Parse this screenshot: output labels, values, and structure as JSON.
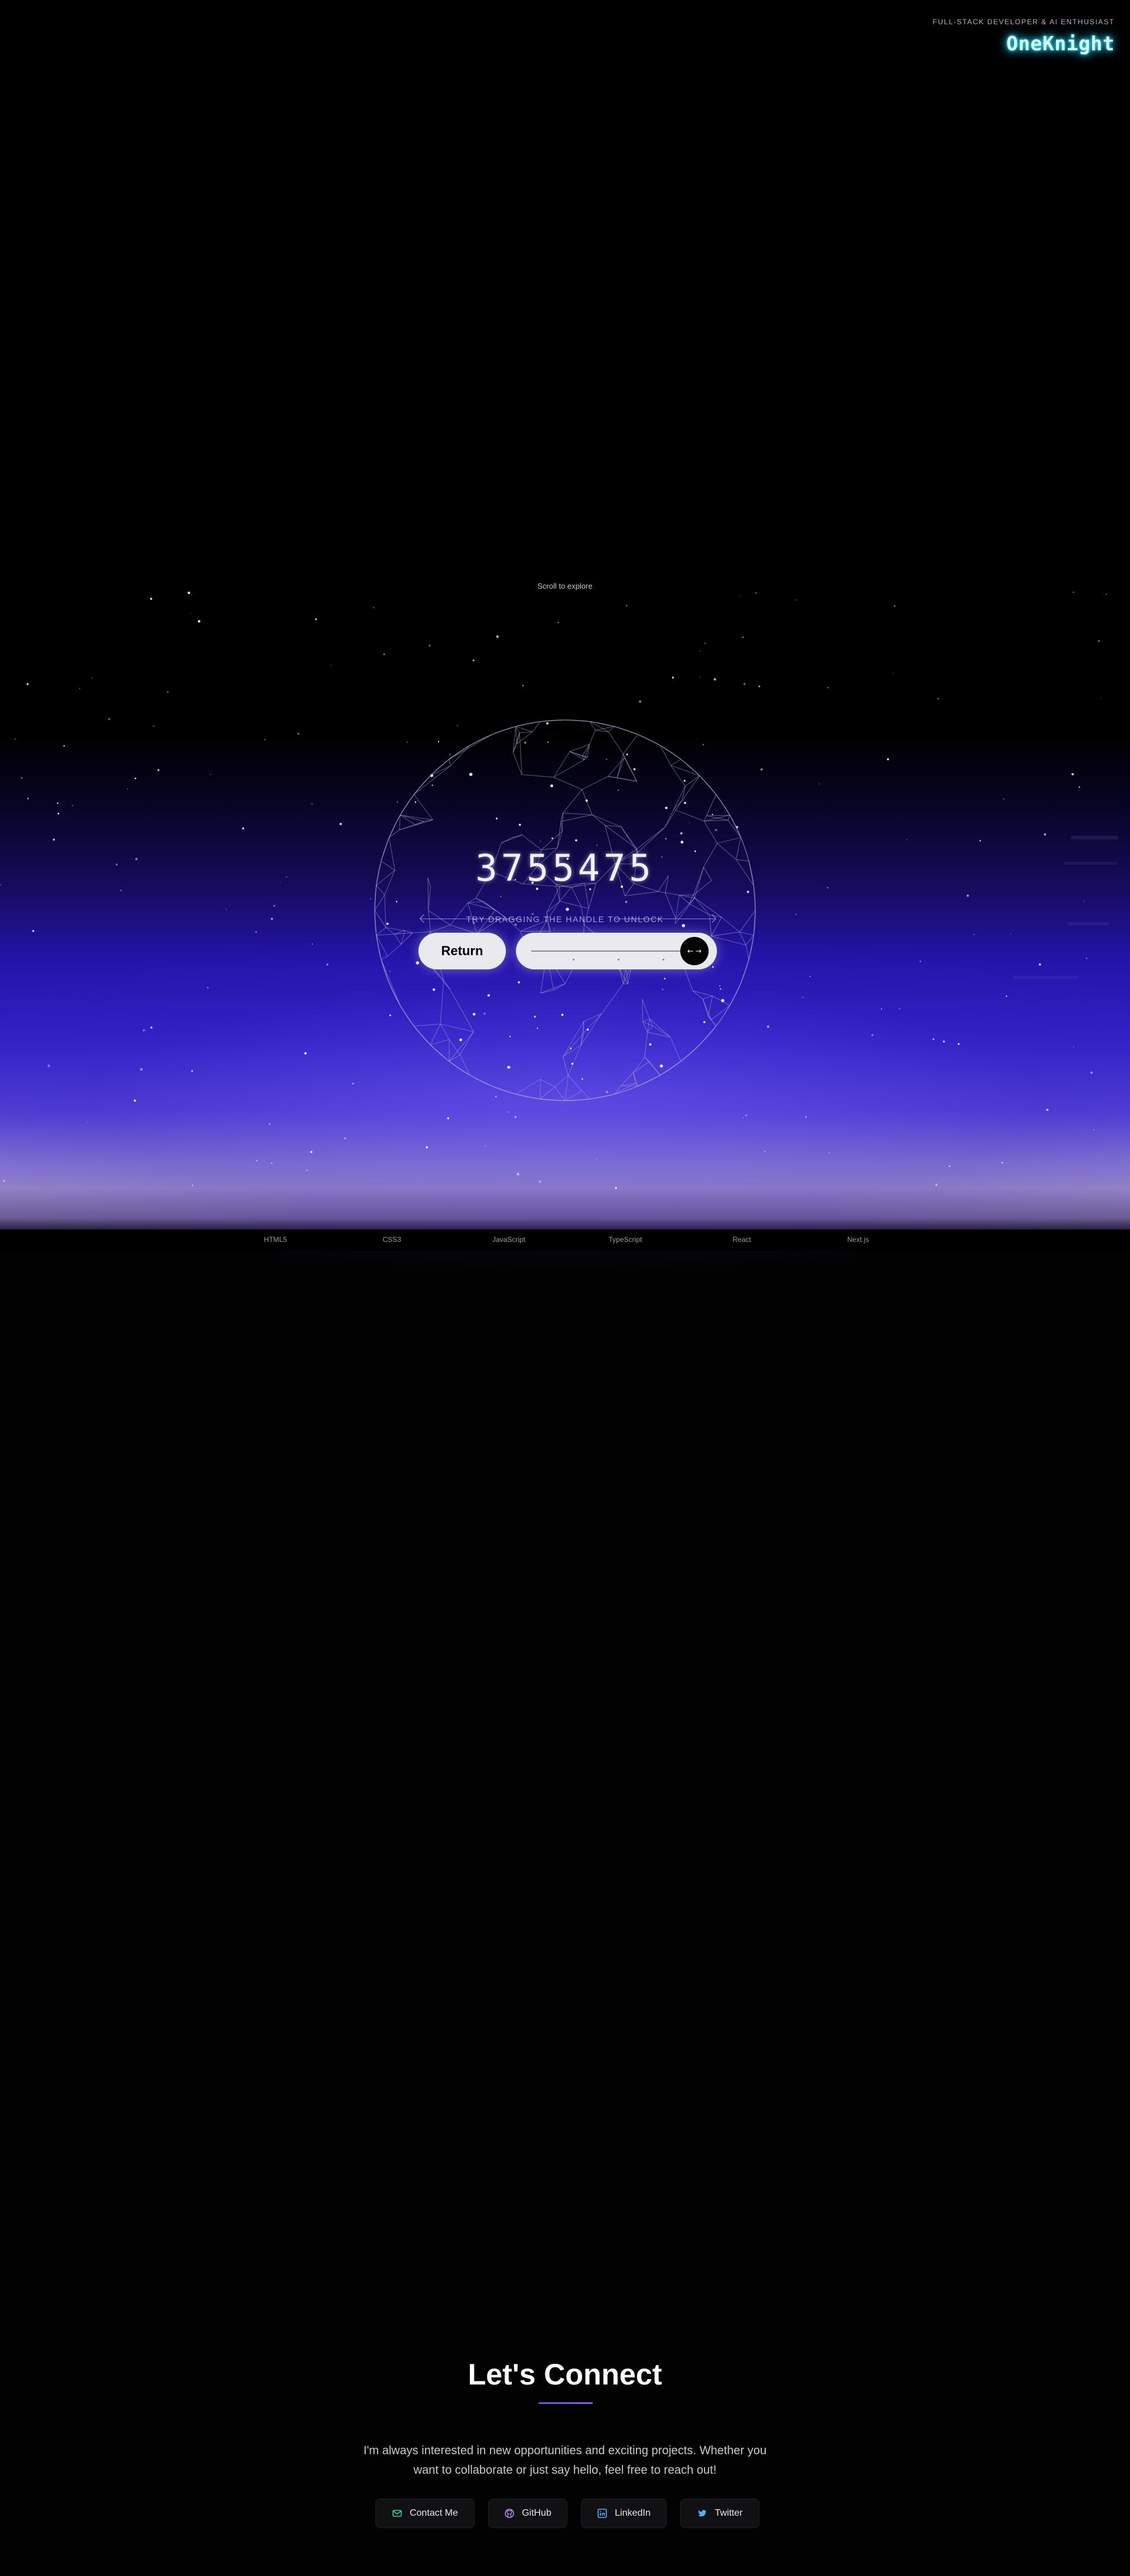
{
  "header": {
    "tagline": "FULL-STACK DEVELOPER & AI ENTHUSIAST",
    "logo": "OneKnight"
  },
  "hero": {
    "scroll_hint": "Scroll to explore",
    "counter": "3755475",
    "drag_hint": "TRY DRAGGING THE HANDLE TO UNLOCK",
    "return_label": "Return",
    "slider_knob_label": "← →",
    "slider_value": 1.0
  },
  "tech_stack": [
    "HTML5",
    "CSS3",
    "JavaScript",
    "TypeScript",
    "React",
    "Next.js"
  ],
  "connect": {
    "title": "Let's Connect",
    "text": "I'm always interested in new opportunities and exciting projects. Whether you want to collaborate or just say hello, feel free to reach out!",
    "buttons": [
      {
        "label": "Contact Me",
        "icon": "mail-icon",
        "color": "#3ecf8e"
      },
      {
        "label": "GitHub",
        "icon": "github-icon",
        "color": "#b48cf2"
      },
      {
        "label": "LinkedIn",
        "icon": "linkedin-icon",
        "color": "#5aa9ff"
      },
      {
        "label": "Twitter",
        "icon": "twitter-icon",
        "color": "#4ab3f4"
      }
    ]
  },
  "colors": {
    "logo_glow": "#3ff2ff",
    "accent_purple": "#8a5cf6",
    "horizon_blue": "#3221c4"
  }
}
